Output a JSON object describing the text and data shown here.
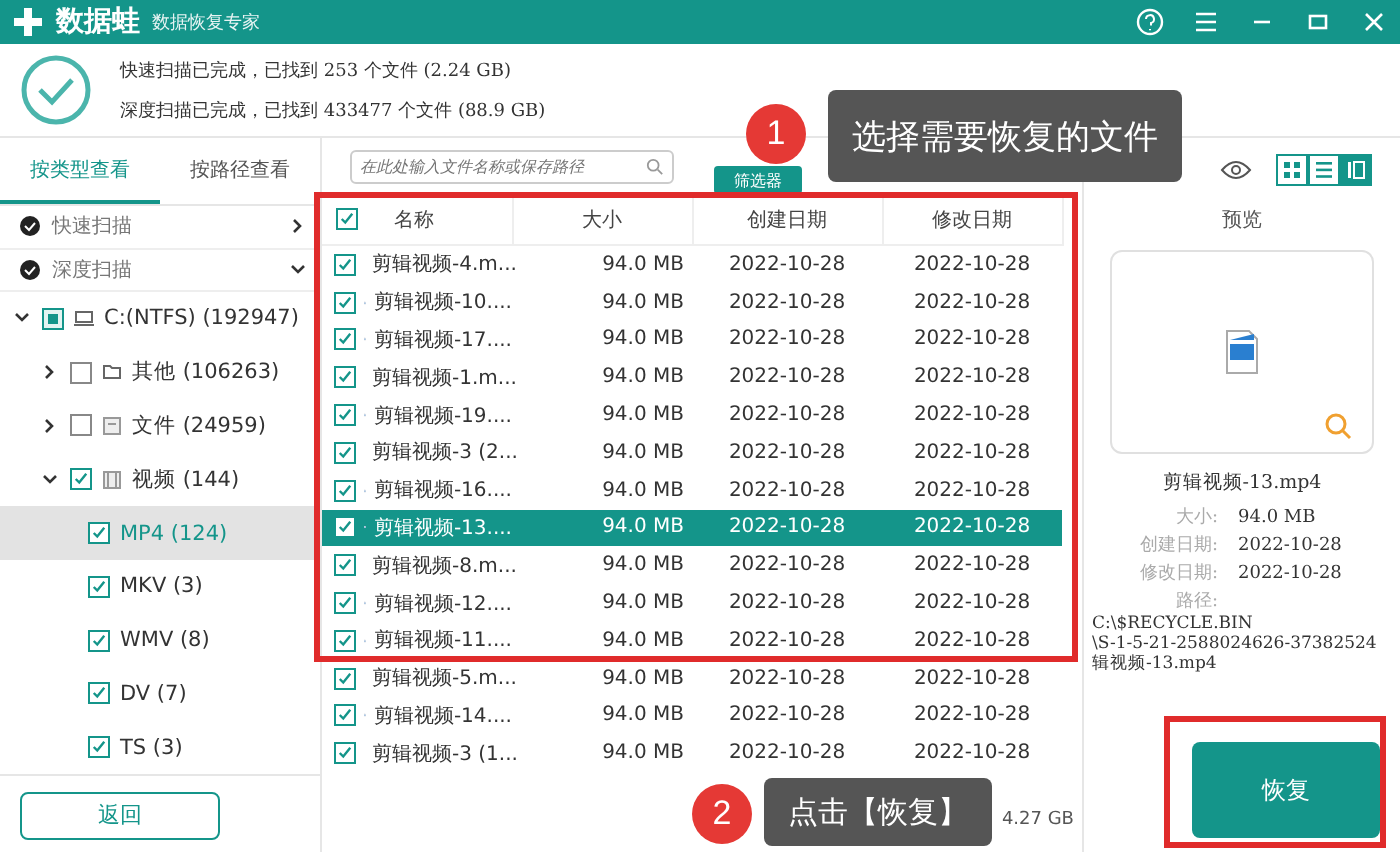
{
  "window": {
    "app_name": "数据蛙",
    "subtitle": "数据恢复专家"
  },
  "scan_summary": [
    "快速扫描已完成，已找到 253 个文件 (2.24 GB)",
    "深度扫描已完成，已找到 433477 个文件 (88.9 GB)"
  ],
  "view_tabs": [
    {
      "label": "按类型查看",
      "selected": true
    },
    {
      "label": "按路径查看",
      "selected": false
    }
  ],
  "scan_groups": [
    {
      "label": "快速扫描",
      "expanded": false
    },
    {
      "label": "深度扫描",
      "expanded": true
    }
  ],
  "tree": [
    {
      "label": "C:(NTFS) (192947)",
      "kind": "drive",
      "checked": false,
      "partial": true,
      "expanded": true,
      "selected": false,
      "children": [
        {
          "label": "其他 (106263)",
          "kind": "folder",
          "checked": false,
          "partial": false,
          "expanded": false,
          "selected": false
        },
        {
          "label": "文件 (24959)",
          "kind": "document",
          "checked": false,
          "partial": false,
          "expanded": false,
          "selected": false
        },
        {
          "label": "视频 (144)",
          "kind": "video",
          "checked": true,
          "partial": false,
          "expanded": true,
          "selected": false,
          "children": [
            {
              "label": "MP4 (124)",
              "checked": true,
              "selected": true
            },
            {
              "label": "MKV (3)",
              "checked": true,
              "selected": false
            },
            {
              "label": "WMV (8)",
              "checked": true,
              "selected": false
            },
            {
              "label": "DV (7)",
              "checked": true,
              "selected": false
            },
            {
              "label": "TS (3)",
              "checked": true,
              "selected": false
            }
          ]
        }
      ]
    }
  ],
  "back_button": "返回",
  "search": {
    "placeholder": "在此处输入文件名称或保存路径"
  },
  "filter_button": "筛选器",
  "view_modes": [
    {
      "kind": "grid",
      "selected": false
    },
    {
      "kind": "list",
      "selected": false
    },
    {
      "kind": "detail",
      "selected": true
    }
  ],
  "table": {
    "all_checked": true,
    "columns": [
      "名称",
      "大小",
      "创建日期",
      "修改日期"
    ],
    "rows": [
      {
        "name": "剪辑视频-4.m...",
        "size": "94.0 MB",
        "created": "2022-10-28",
        "modified": "2022-10-28",
        "checked": true,
        "selected": false
      },
      {
        "name": "剪辑视频-10....",
        "size": "94.0 MB",
        "created": "2022-10-28",
        "modified": "2022-10-28",
        "checked": true,
        "selected": false
      },
      {
        "name": "剪辑视频-17....",
        "size": "94.0 MB",
        "created": "2022-10-28",
        "modified": "2022-10-28",
        "checked": true,
        "selected": false
      },
      {
        "name": "剪辑视频-1.m...",
        "size": "94.0 MB",
        "created": "2022-10-28",
        "modified": "2022-10-28",
        "checked": true,
        "selected": false
      },
      {
        "name": "剪辑视频-19....",
        "size": "94.0 MB",
        "created": "2022-10-28",
        "modified": "2022-10-28",
        "checked": true,
        "selected": false
      },
      {
        "name": "剪辑视频-3 (2...",
        "size": "94.0 MB",
        "created": "2022-10-28",
        "modified": "2022-10-28",
        "checked": true,
        "selected": false
      },
      {
        "name": "剪辑视频-16....",
        "size": "94.0 MB",
        "created": "2022-10-28",
        "modified": "2022-10-28",
        "checked": true,
        "selected": false
      },
      {
        "name": "剪辑视频-13....",
        "size": "94.0 MB",
        "created": "2022-10-28",
        "modified": "2022-10-28",
        "checked": true,
        "selected": true
      },
      {
        "name": "剪辑视频-8.m...",
        "size": "94.0 MB",
        "created": "2022-10-28",
        "modified": "2022-10-28",
        "checked": true,
        "selected": false
      },
      {
        "name": "剪辑视频-12....",
        "size": "94.0 MB",
        "created": "2022-10-28",
        "modified": "2022-10-28",
        "checked": true,
        "selected": false
      },
      {
        "name": "剪辑视频-11....",
        "size": "94.0 MB",
        "created": "2022-10-28",
        "modified": "2022-10-28",
        "checked": true,
        "selected": false
      },
      {
        "name": "剪辑视频-5.m...",
        "size": "94.0 MB",
        "created": "2022-10-28",
        "modified": "2022-10-28",
        "checked": true,
        "selected": false
      },
      {
        "name": "剪辑视频-14....",
        "size": "94.0 MB",
        "created": "2022-10-28",
        "modified": "2022-10-28",
        "checked": true,
        "selected": false
      },
      {
        "name": "剪辑视频-3 (1...",
        "size": "94.0 MB",
        "created": "2022-10-28",
        "modified": "2022-10-28",
        "checked": true,
        "selected": false
      }
    ]
  },
  "status_text": "4.27 GB",
  "preview": {
    "title": "预览",
    "file_name": "剪辑视频-13.mp4",
    "details": [
      {
        "label": "大小:",
        "value": "94.0 MB"
      },
      {
        "label": "创建日期:",
        "value": "2022-10-28"
      },
      {
        "label": "修改日期:",
        "value": "2022-10-28"
      },
      {
        "label": "路径:"
      }
    ],
    "path_lines": [
      "C:\\$RECYCLE.BIN",
      "\\S-1-5-21-2588024626-37382524",
      "辑视频-13.mp4"
    ]
  },
  "recover_button": "恢复",
  "callouts": [
    {
      "number": "1",
      "text": "选择需要恢复的文件"
    },
    {
      "number": "2",
      "text": "点击【恢复】"
    }
  ]
}
